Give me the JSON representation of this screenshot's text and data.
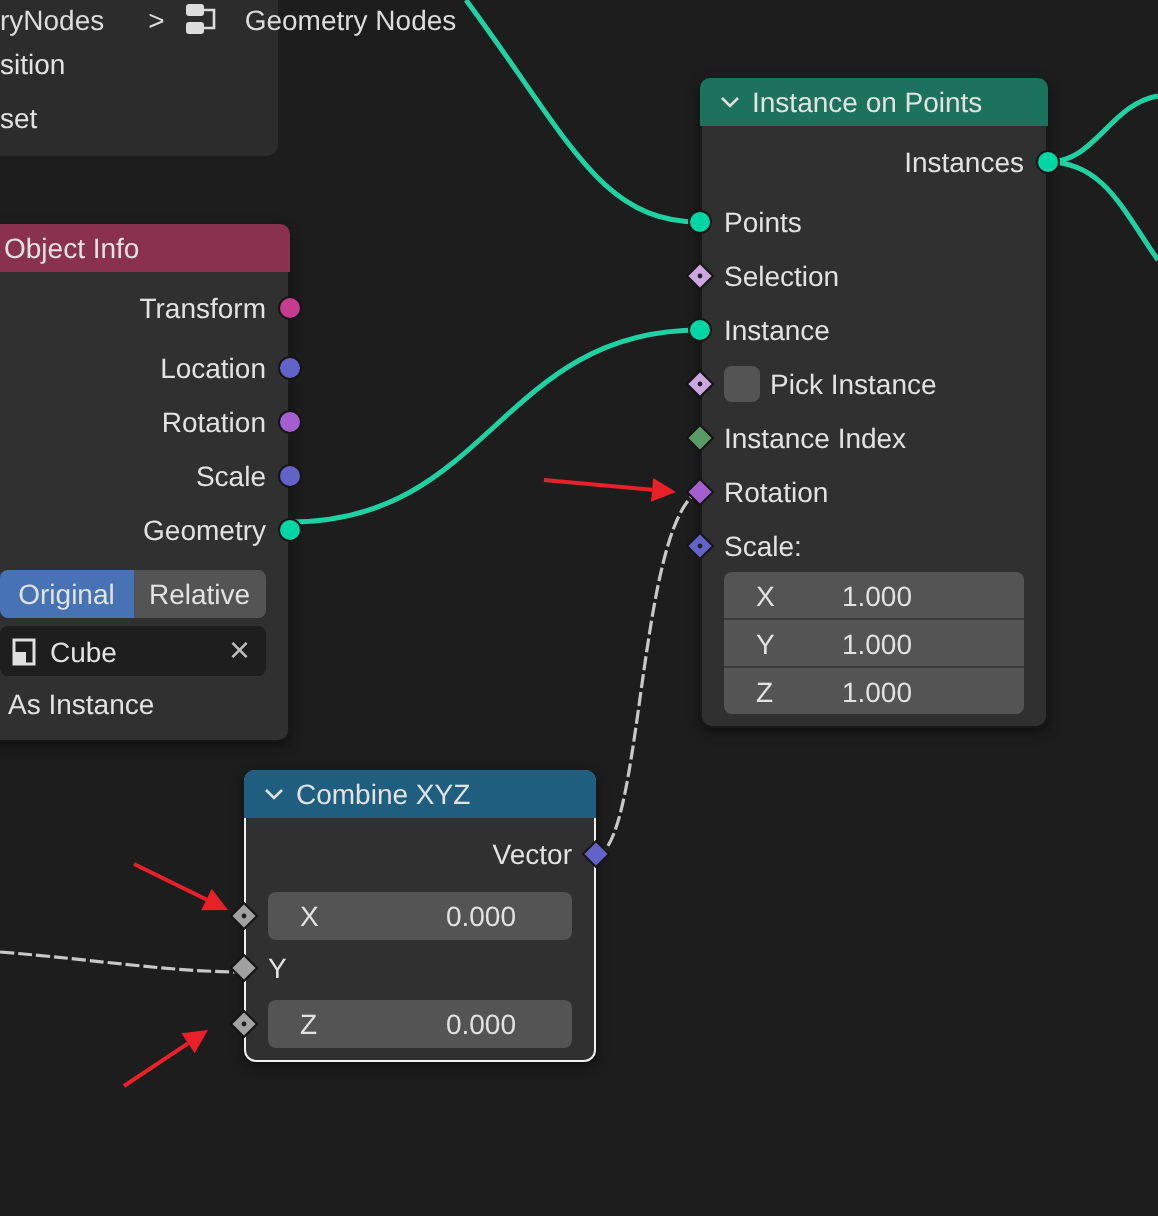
{
  "breadcrumb": {
    "items": [
      "ryNodes",
      "Geometry Nodes"
    ],
    "separator": ">"
  },
  "nodes": [
    {
      "kind": "menu",
      "items": [
        "sition",
        "set"
      ]
    },
    {
      "kind": "node",
      "title": "Object Info",
      "color": "#8a3150",
      "selected": false,
      "rows": [
        {
          "kind": "output",
          "label": "Transform",
          "socket": {
            "kind": "circle",
            "color": "#c43c91"
          }
        },
        {
          "kind": "output",
          "label": "Location",
          "socket": {
            "kind": "circle",
            "color": "#6363c7"
          }
        },
        {
          "kind": "output",
          "label": "Rotation",
          "socket": {
            "kind": "circle",
            "color": "#a35fd0"
          }
        },
        {
          "kind": "output",
          "label": "Scale",
          "socket": {
            "kind": "circle",
            "color": "#6363c7"
          }
        },
        {
          "kind": "output",
          "label": "Geometry",
          "socket": {
            "kind": "circle",
            "color": "#00d6a3"
          }
        },
        {
          "kind": "toggle",
          "options": [
            {
              "label": "Original",
              "selected": true
            },
            {
              "label": "Relative",
              "selected": false
            }
          ]
        },
        {
          "kind": "object",
          "value": "Cube",
          "clear": "×"
        },
        {
          "kind": "text",
          "label": "As Instance"
        }
      ]
    },
    {
      "kind": "node",
      "title": "Instance on Points",
      "color": "#1d725e",
      "expanded": true,
      "selected": false,
      "rows": [
        {
          "kind": "output",
          "label": "Instances",
          "socket": {
            "kind": "circle",
            "color": "#00d6a3"
          }
        },
        {
          "kind": "input",
          "label": "Points",
          "socket": {
            "kind": "circle",
            "color": "#00d6a3"
          }
        },
        {
          "kind": "input",
          "label": "Selection",
          "socket": {
            "kind": "diamond_dot",
            "color": "#cca6e0"
          }
        },
        {
          "kind": "input",
          "label": "Instance",
          "socket": {
            "kind": "circle",
            "color": "#00d6a3"
          }
        },
        {
          "kind": "checkbox",
          "label": "Pick Instance",
          "checked": false,
          "socket": {
            "kind": "diamond_dot",
            "color": "#cca6e0"
          }
        },
        {
          "kind": "input",
          "label": "Instance Index",
          "socket": {
            "kind": "diamond",
            "color": "#5a9a64"
          }
        },
        {
          "kind": "input",
          "label": "Rotation",
          "socket": {
            "kind": "diamond",
            "color": "#a35fd0"
          }
        },
        {
          "kind": "input",
          "label": "Scale:",
          "socket": {
            "kind": "diamond_dot",
            "color": "#6363c7"
          }
        },
        {
          "kind": "vector",
          "fields": [
            {
              "label": "X",
              "value": "1.000"
            },
            {
              "label": "Y",
              "value": "1.000"
            },
            {
              "label": "Z",
              "value": "1.000"
            }
          ]
        }
      ]
    },
    {
      "kind": "node",
      "title": "Combine XYZ",
      "color": "#1f5e7e",
      "expanded": true,
      "selected": true,
      "rows": [
        {
          "kind": "output",
          "label": "Vector",
          "socket": {
            "kind": "diamond",
            "color": "#6363c7"
          }
        },
        {
          "kind": "field",
          "label": "X",
          "value": "0.000",
          "socket": {
            "kind": "diamond_dot",
            "color": "#a1a1a1"
          }
        },
        {
          "kind": "input",
          "label": "Y",
          "socket": {
            "kind": "diamond",
            "color": "#a1a1a1"
          }
        },
        {
          "kind": "field",
          "label": "Z",
          "value": "0.000",
          "socket": {
            "kind": "diamond_dot",
            "color": "#a1a1a1"
          }
        }
      ]
    }
  ]
}
